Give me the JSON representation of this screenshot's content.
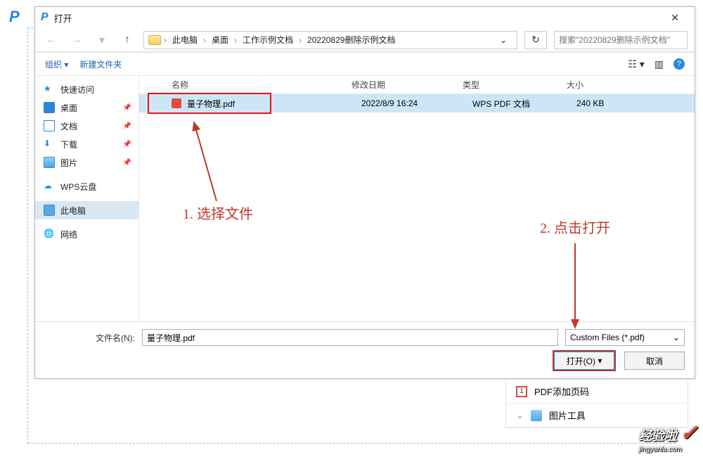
{
  "window": {
    "title": "打开"
  },
  "breadcrumbs": [
    "此电脑",
    "桌面",
    "工作示例文档",
    "20220829删除示例文档"
  ],
  "search": {
    "placeholder": "搜索\"20220829删除示例文档\""
  },
  "toolbar": {
    "organize": "组织",
    "newfolder": "新建文件夹"
  },
  "columns": {
    "name": "名称",
    "modified": "修改日期",
    "type": "类型",
    "size": "大小"
  },
  "sidebar": {
    "quick": "快速访问",
    "desktop": "桌面",
    "docs": "文档",
    "downloads": "下载",
    "pictures": "图片",
    "wps": "WPS云盘",
    "pc": "此电脑",
    "network": "网络"
  },
  "files": [
    {
      "name": "量子物理.pdf",
      "modified": "2022/8/9 16:24",
      "type": "WPS PDF 文档",
      "size": "240 KB"
    }
  ],
  "annotations": {
    "step1": "1. 选择文件",
    "step2": "2. 点击打开"
  },
  "footer": {
    "filename_label": "文件名(N):",
    "filename_value": "量子物理.pdf",
    "filter": "Custom Files (*.pdf)",
    "open": "打开(O)",
    "cancel": "取消"
  },
  "tool_panel": {
    "row1": "PDF添加页码",
    "row2": "图片工具"
  },
  "watermark": {
    "main": "经验啦",
    "sub": "jingyanla.com"
  }
}
